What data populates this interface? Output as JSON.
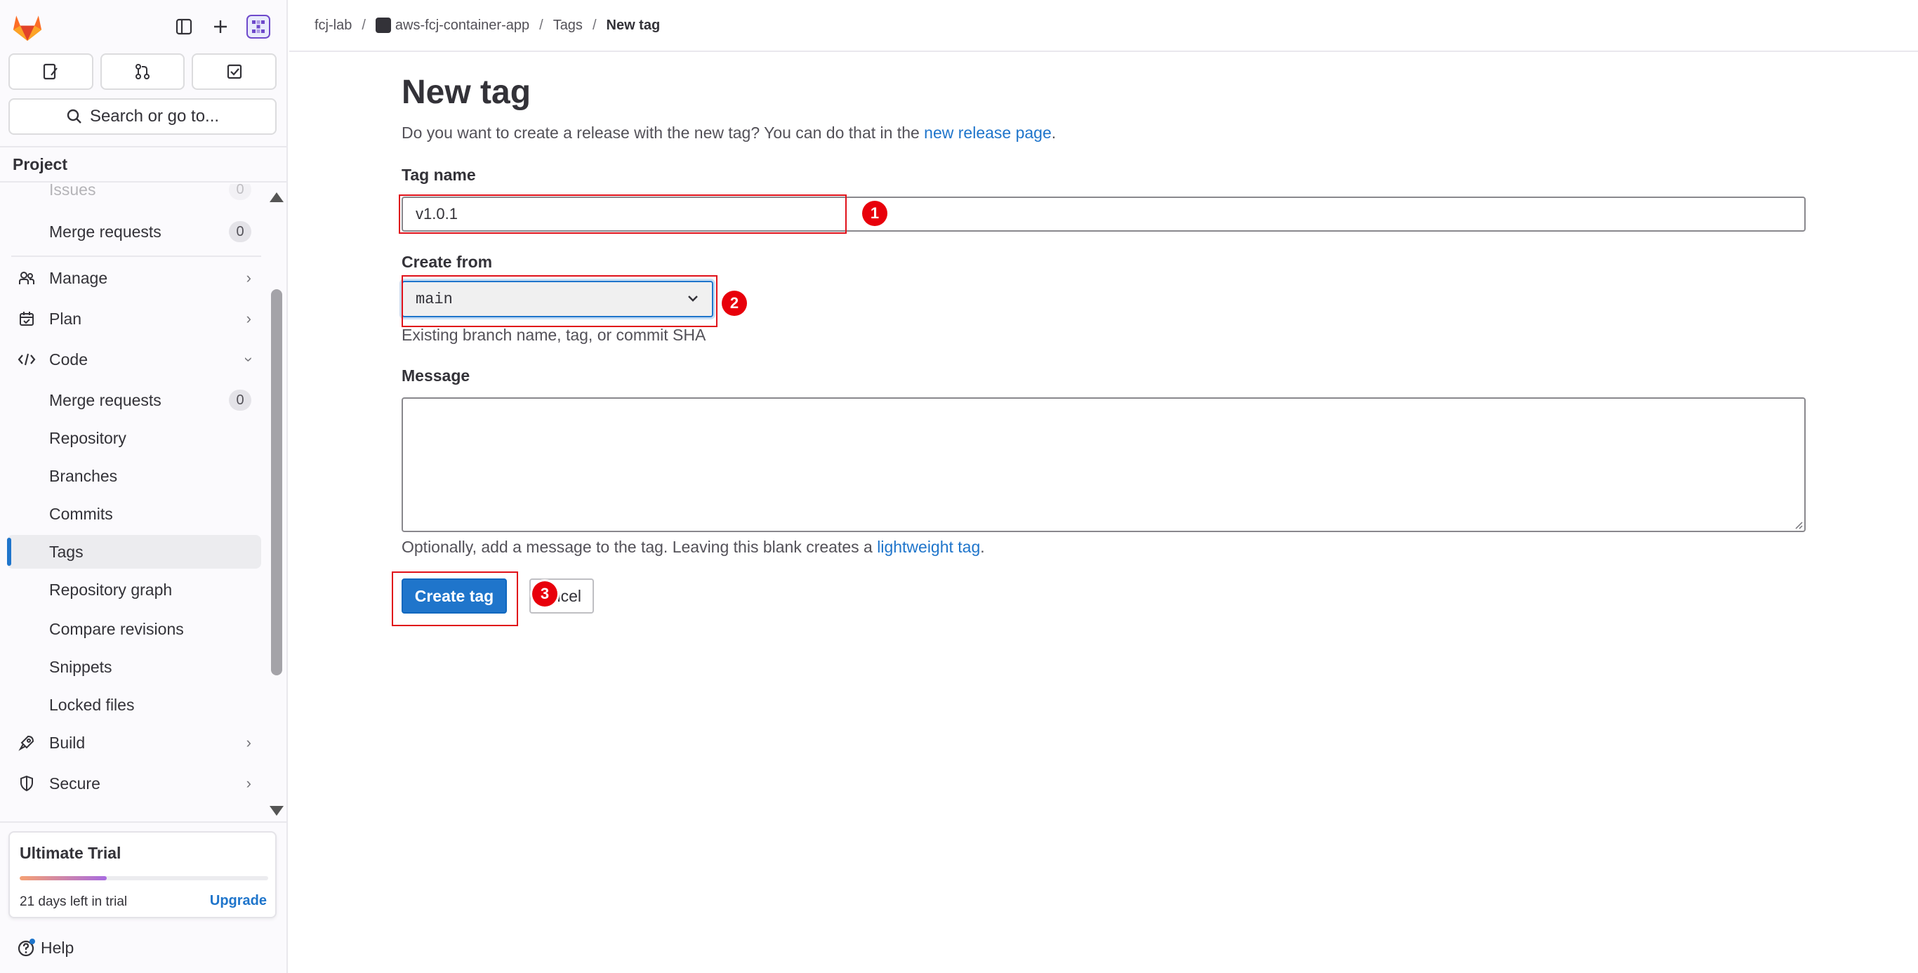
{
  "sidebar": {
    "search_label": "Search or go to...",
    "section_title": "Project",
    "items": [
      {
        "label": "Issues",
        "badge": "0"
      },
      {
        "label": "Merge requests",
        "badge": "0"
      },
      {
        "label": "Manage"
      },
      {
        "label": "Plan"
      },
      {
        "label": "Code"
      },
      {
        "label": "Merge requests",
        "badge": "0"
      },
      {
        "label": "Repository"
      },
      {
        "label": "Branches"
      },
      {
        "label": "Commits"
      },
      {
        "label": "Tags"
      },
      {
        "label": "Repository graph"
      },
      {
        "label": "Compare revisions"
      },
      {
        "label": "Snippets"
      },
      {
        "label": "Locked files"
      },
      {
        "label": "Build"
      },
      {
        "label": "Secure"
      }
    ],
    "trial": {
      "title": "Ultimate Trial",
      "days_left": "21 days left in trial",
      "upgrade": "Upgrade",
      "progress": 0.35
    },
    "help": "Help"
  },
  "breadcrumb": {
    "group": "fcj-lab",
    "project": "aws-fcj-container-app",
    "section": "Tags",
    "current": "New tag"
  },
  "form": {
    "title": "New tag",
    "description_prefix": "Do you want to create a release with the new tag? You can do that in the ",
    "description_link": "new release page",
    "description_suffix": ".",
    "tag_name_label": "Tag name",
    "tag_name_value": "v1.0.1",
    "create_from_label": "Create from",
    "create_from_value": "main",
    "create_from_help": "Existing branch name, tag, or commit SHA",
    "message_label": "Message",
    "message_help_prefix": "Optionally, add a message to the tag. Leaving this blank creates a ",
    "message_help_link": "lightweight tag",
    "message_help_suffix": ".",
    "create_button": "Create tag",
    "cancel_button": "Cancel"
  },
  "annotations": [
    "1",
    "2",
    "3"
  ],
  "colors": {
    "accent": "#1f75cb",
    "annotation": "#e0111a"
  }
}
